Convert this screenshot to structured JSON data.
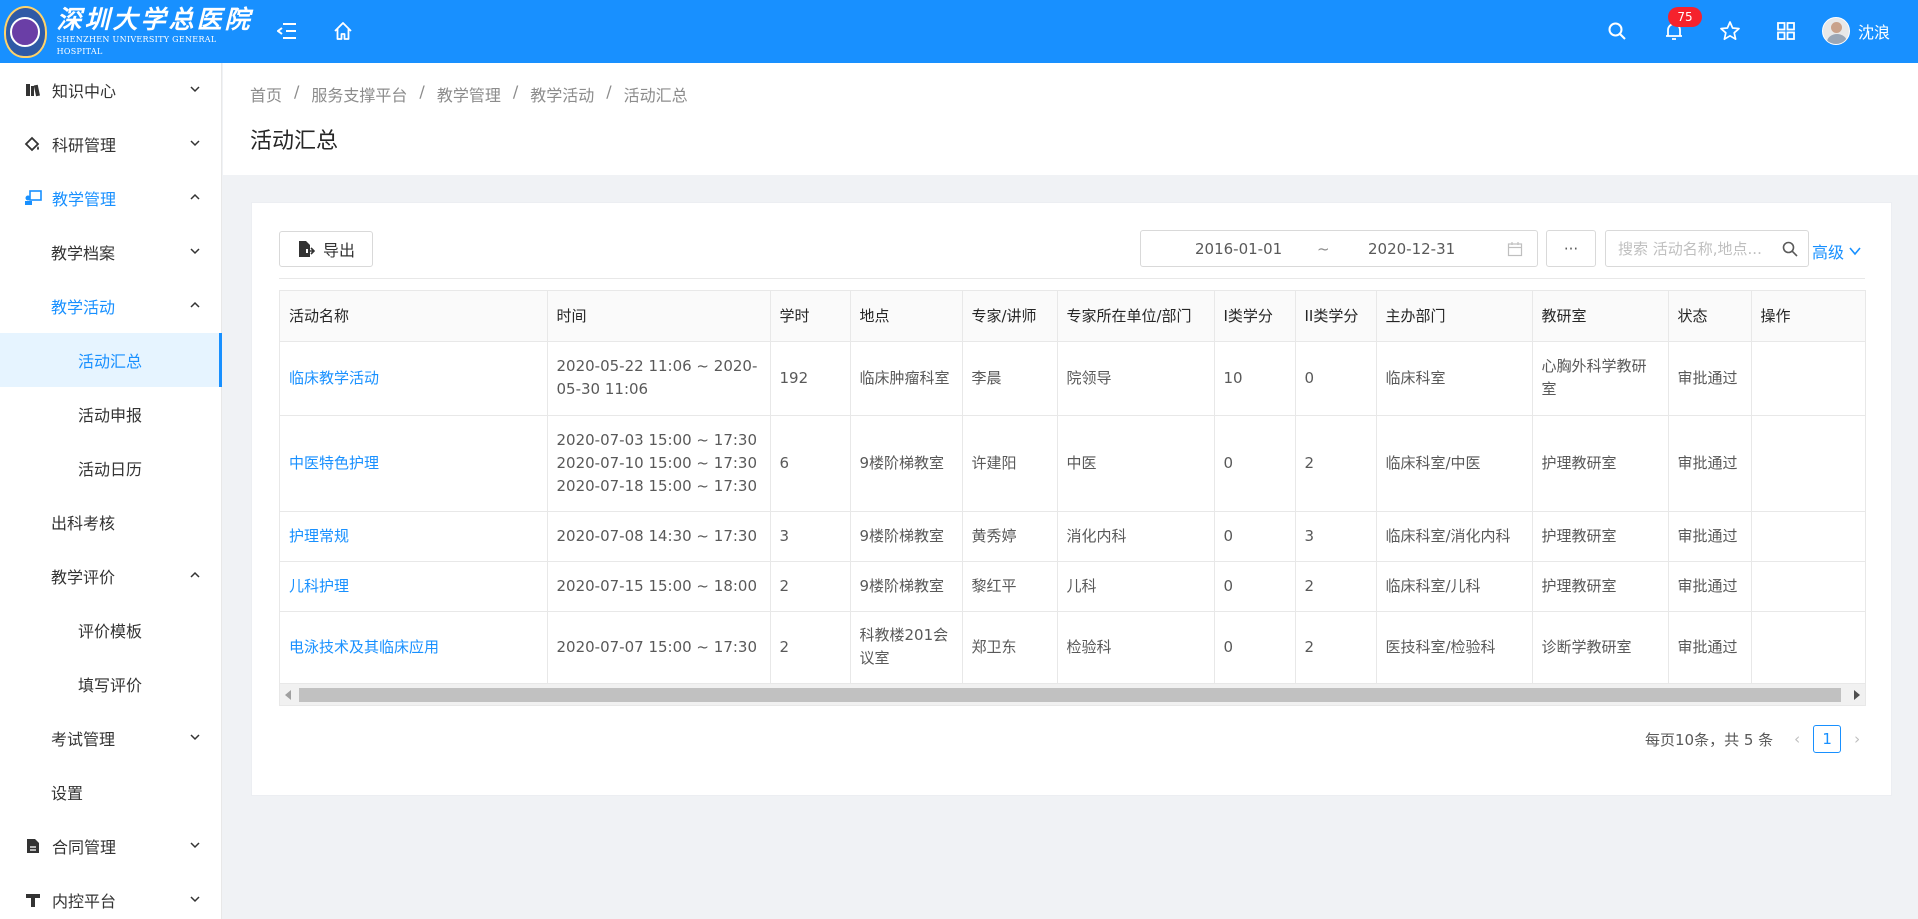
{
  "header": {
    "logo_cn": "深圳大学总医院",
    "logo_en": "SHENZHEN UNIVERSITY GENERAL HOSPITAL",
    "notification_count": "75",
    "user_name": "沈浪",
    "accent_color": "#1890ff"
  },
  "sidebar": {
    "items": [
      {
        "label": "知识中心",
        "icon": "book-icon",
        "level": 1,
        "chevron": "down"
      },
      {
        "label": "科研管理",
        "icon": "flask-icon",
        "level": 1,
        "chevron": "down"
      },
      {
        "label": "教学管理",
        "icon": "teaching-icon",
        "level": 1,
        "chevron": "up",
        "state": "active-parent"
      },
      {
        "label": "教学档案",
        "level": 2,
        "chevron": "down"
      },
      {
        "label": "教学活动",
        "level": 2,
        "chevron": "up",
        "state": "active-parent"
      },
      {
        "label": "活动汇总",
        "level": 3,
        "state": "selected"
      },
      {
        "label": "活动申报",
        "level": 3
      },
      {
        "label": "活动日历",
        "level": 3
      },
      {
        "label": "出科考核",
        "level": 2
      },
      {
        "label": "教学评价",
        "level": 2,
        "chevron": "up"
      },
      {
        "label": "评价模板",
        "level": 3
      },
      {
        "label": "填写评价",
        "level": 3
      },
      {
        "label": "考试管理",
        "level": 2,
        "chevron": "down"
      },
      {
        "label": "设置",
        "level": 2
      },
      {
        "label": "合同管理",
        "icon": "contract-icon",
        "level": 1,
        "chevron": "down"
      },
      {
        "label": "内控平台",
        "icon": "control-icon",
        "level": 1,
        "chevron": "down"
      }
    ]
  },
  "breadcrumb": [
    "首页",
    "服务支撑平台",
    "教学管理",
    "教学活动",
    "活动汇总"
  ],
  "page_title": "活动汇总",
  "toolbar": {
    "export_label": "导出",
    "date_start": "2016-01-01",
    "date_sep": "~",
    "date_end": "2020-12-31",
    "more_label": "···",
    "search_placeholder": "搜索 活动名称,地点...",
    "advanced_label": "高级"
  },
  "table": {
    "columns": [
      "活动名称",
      "时间",
      "学时",
      "地点",
      "专家/讲师",
      "专家所在单位/部门",
      "I类学分",
      "II类学分",
      "主办部门",
      "教研室",
      "状态",
      "操作"
    ],
    "rows": [
      {
        "name": "临床教学活动",
        "time": [
          "2020-05-22 11:06 ~ 2020-05-30 11:06"
        ],
        "hours": "192",
        "place": "临床肿瘤科室",
        "expert": "李晨",
        "unit": "院领导",
        "credit1": "10",
        "credit2": "0",
        "dept": "临床科室",
        "office": "心胸外科学教研室",
        "status": "审批通过",
        "op": ""
      },
      {
        "name": "中医特色护理",
        "time": [
          "2020-07-03 15:00 ~ 17:30",
          "2020-07-10 15:00 ~ 17:30",
          "2020-07-18 15:00 ~ 17:30"
        ],
        "hours": "6",
        "place": "9楼阶梯教室",
        "expert": "许建阳",
        "unit": "中医",
        "credit1": "0",
        "credit2": "2",
        "dept": "临床科室/中医",
        "office": "护理教研室",
        "status": "审批通过",
        "op": ""
      },
      {
        "name": "护理常规",
        "time": [
          "2020-07-08 14:30 ~ 17:30"
        ],
        "hours": "3",
        "place": "9楼阶梯教室",
        "expert": "黄秀婷",
        "unit": "消化内科",
        "credit1": "0",
        "credit2": "3",
        "dept": "临床科室/消化内科",
        "office": "护理教研室",
        "status": "审批通过",
        "op": ""
      },
      {
        "name": "儿科护理",
        "time": [
          "2020-07-15 15:00 ~ 18:00"
        ],
        "hours": "2",
        "place": "9楼阶梯教室",
        "expert": "黎红平",
        "unit": "儿科",
        "credit1": "0",
        "credit2": "2",
        "dept": "临床科室/儿科",
        "office": "护理教研室",
        "status": "审批通过",
        "op": ""
      },
      {
        "name": "电泳技术及其临床应用",
        "time": [
          "2020-07-07 15:00 ~ 17:30"
        ],
        "hours": "2",
        "place": "科教楼201会议室",
        "expert": "郑卫东",
        "unit": "检验科",
        "credit1": "0",
        "credit2": "2",
        "dept": "医技科室/检验科",
        "office": "诊断学教研室",
        "status": "审批通过",
        "op": ""
      }
    ]
  },
  "pagination": {
    "summary": "每页10条，共 5 条",
    "current_page": "1"
  }
}
